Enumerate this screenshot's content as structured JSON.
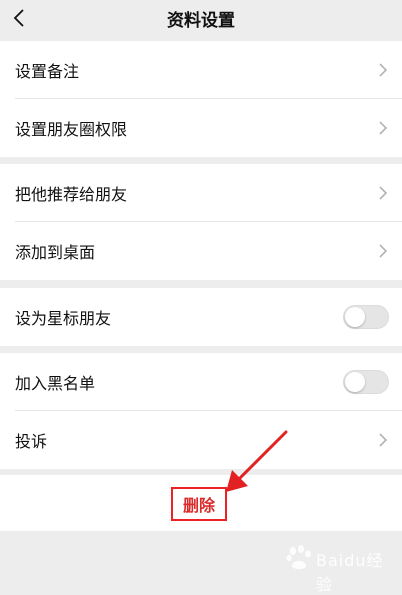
{
  "nav": {
    "title": "资料设置"
  },
  "groups": [
    {
      "items": [
        {
          "label": "设置备注"
        },
        {
          "label": "设置朋友圈权限"
        }
      ]
    },
    {
      "items": [
        {
          "label": "把他推荐给朋友"
        },
        {
          "label": "添加到桌面"
        }
      ]
    },
    {
      "items": [
        {
          "label": "设为星标朋友",
          "toggle": false
        }
      ]
    },
    {
      "items": [
        {
          "label": "加入黑名单",
          "toggle": false
        },
        {
          "label": "投诉"
        }
      ]
    }
  ],
  "delete": {
    "label": "删除"
  },
  "colors": {
    "highlight": "#e22222",
    "delete_text": "#d92b2b",
    "background": "#ededed"
  },
  "watermark": {
    "text": "Baidu经验"
  }
}
